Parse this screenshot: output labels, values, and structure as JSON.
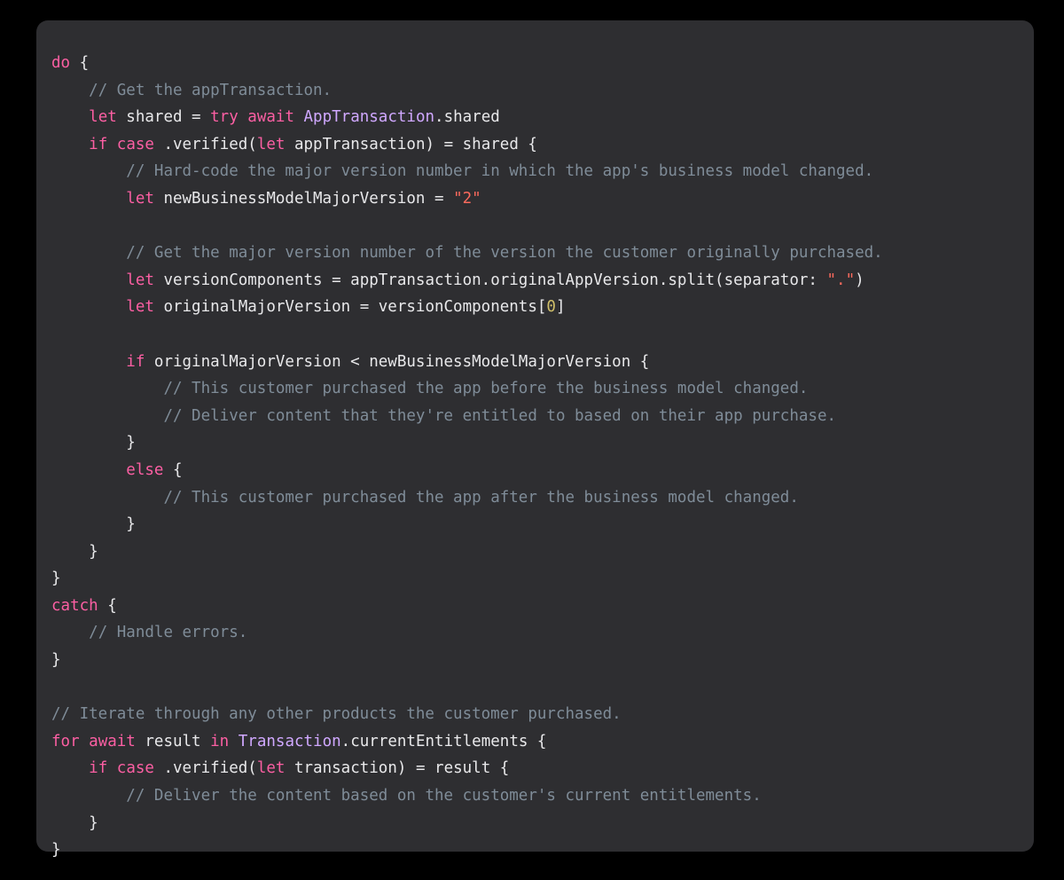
{
  "colors": {
    "background": "#000000",
    "card": "#2e2e31",
    "plain": "#e8e8ea",
    "keyword": "#fc5fa3",
    "comment": "#7f8c98",
    "type": "#d0a8ff",
    "string": "#fc6a5d",
    "number": "#d0bf69"
  },
  "code": {
    "language": "swift",
    "lines": [
      [
        [
          "keyword",
          "do"
        ],
        [
          "plain",
          " {"
        ]
      ],
      [
        [
          "plain",
          "    "
        ],
        [
          "comment",
          "// Get the appTransaction."
        ]
      ],
      [
        [
          "plain",
          "    "
        ],
        [
          "keyword",
          "let"
        ],
        [
          "plain",
          " shared = "
        ],
        [
          "keyword",
          "try"
        ],
        [
          "plain",
          " "
        ],
        [
          "keyword",
          "await"
        ],
        [
          "plain",
          " "
        ],
        [
          "type",
          "AppTransaction"
        ],
        [
          "plain",
          ".shared"
        ]
      ],
      [
        [
          "plain",
          "    "
        ],
        [
          "keyword",
          "if"
        ],
        [
          "plain",
          " "
        ],
        [
          "keyword",
          "case"
        ],
        [
          "plain",
          " .verified("
        ],
        [
          "keyword",
          "let"
        ],
        [
          "plain",
          " appTransaction) = shared {"
        ]
      ],
      [
        [
          "plain",
          "        "
        ],
        [
          "comment",
          "// Hard-code the major version number in which the app's business model changed."
        ]
      ],
      [
        [
          "plain",
          "        "
        ],
        [
          "keyword",
          "let"
        ],
        [
          "plain",
          " newBusinessModelMajorVersion = "
        ],
        [
          "string",
          "\"2\""
        ]
      ],
      [],
      [
        [
          "plain",
          "        "
        ],
        [
          "comment",
          "// Get the major version number of the version the customer originally purchased."
        ]
      ],
      [
        [
          "plain",
          "        "
        ],
        [
          "keyword",
          "let"
        ],
        [
          "plain",
          " versionComponents = appTransaction.originalAppVersion.split(separator: "
        ],
        [
          "string",
          "\".\""
        ],
        [
          "plain",
          ")"
        ]
      ],
      [
        [
          "plain",
          "        "
        ],
        [
          "keyword",
          "let"
        ],
        [
          "plain",
          " originalMajorVersion = versionComponents["
        ],
        [
          "number",
          "0"
        ],
        [
          "plain",
          "]"
        ]
      ],
      [],
      [
        [
          "plain",
          "        "
        ],
        [
          "keyword",
          "if"
        ],
        [
          "plain",
          " originalMajorVersion < newBusinessModelMajorVersion {"
        ]
      ],
      [
        [
          "plain",
          "            "
        ],
        [
          "comment",
          "// This customer purchased the app before the business model changed."
        ]
      ],
      [
        [
          "plain",
          "            "
        ],
        [
          "comment",
          "// Deliver content that they're entitled to based on their app purchase."
        ]
      ],
      [
        [
          "plain",
          "        }"
        ]
      ],
      [
        [
          "plain",
          "        "
        ],
        [
          "keyword",
          "else"
        ],
        [
          "plain",
          " {"
        ]
      ],
      [
        [
          "plain",
          "            "
        ],
        [
          "comment",
          "// This customer purchased the app after the business model changed."
        ]
      ],
      [
        [
          "plain",
          "        }"
        ]
      ],
      [
        [
          "plain",
          "    }"
        ]
      ],
      [
        [
          "plain",
          "}"
        ]
      ],
      [
        [
          "keyword",
          "catch"
        ],
        [
          "plain",
          " {"
        ]
      ],
      [
        [
          "plain",
          "    "
        ],
        [
          "comment",
          "// Handle errors."
        ]
      ],
      [
        [
          "plain",
          "}"
        ]
      ],
      [],
      [
        [
          "comment",
          "// Iterate through any other products the customer purchased."
        ]
      ],
      [
        [
          "keyword",
          "for"
        ],
        [
          "plain",
          " "
        ],
        [
          "keyword",
          "await"
        ],
        [
          "plain",
          " result "
        ],
        [
          "keyword",
          "in"
        ],
        [
          "plain",
          " "
        ],
        [
          "type",
          "Transaction"
        ],
        [
          "plain",
          ".currentEntitlements {"
        ]
      ],
      [
        [
          "plain",
          "    "
        ],
        [
          "keyword",
          "if"
        ],
        [
          "plain",
          " "
        ],
        [
          "keyword",
          "case"
        ],
        [
          "plain",
          " .verified("
        ],
        [
          "keyword",
          "let"
        ],
        [
          "plain",
          " transaction) = result {"
        ]
      ],
      [
        [
          "plain",
          "        "
        ],
        [
          "comment",
          "// Deliver the content based on the customer's current entitlements."
        ]
      ],
      [
        [
          "plain",
          "    }"
        ]
      ],
      [
        [
          "plain",
          "}"
        ]
      ]
    ]
  }
}
